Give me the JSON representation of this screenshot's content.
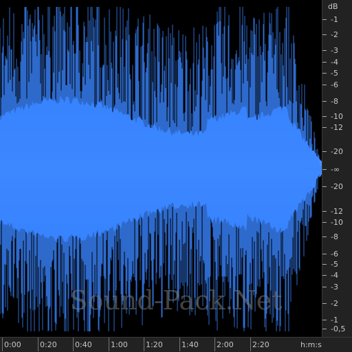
{
  "watermark": "Sound-Pack.Net",
  "colors": {
    "waveform": "#3a86ff",
    "background": "#000000",
    "ruler_bg": "#222222",
    "ruler_text": "#c8c8c8"
  },
  "db_ruler": {
    "unit": "dB",
    "labels": [
      "-1",
      "-2",
      "-3",
      "-4",
      "-5",
      "-6",
      "-8",
      "-10",
      "-12",
      "-20",
      "-∞",
      "-20",
      "-12",
      "-10",
      "-8",
      "-6",
      "-5",
      "-4",
      "-3",
      "-2",
      "-1",
      "-0,5"
    ]
  },
  "time_ruler": {
    "unit": "h:m:s",
    "labels": [
      "0:00",
      "0:20",
      "0:40",
      "1:00",
      "1:20",
      "1:40",
      "2:00",
      "2:20"
    ]
  }
}
